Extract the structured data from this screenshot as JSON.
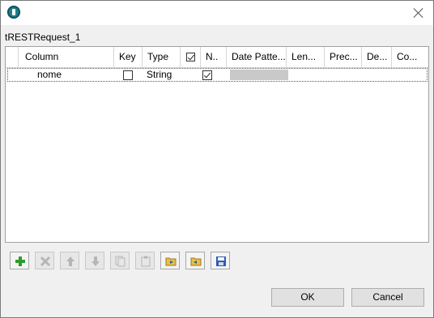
{
  "window": {
    "component_name": "tRESTRequest_1"
  },
  "table": {
    "columns": [
      "Column",
      "Key",
      "Type",
      "",
      "N..",
      "Date Patte...",
      "Len...",
      "Prec...",
      "De...",
      "Co..."
    ],
    "rows": [
      {
        "column": "nome",
        "key": false,
        "type": "String",
        "nullable": true,
        "date_pattern": "",
        "length": "",
        "precision": "",
        "default": "",
        "comment": ""
      }
    ]
  },
  "toolbar": {
    "buttons": [
      {
        "name": "add-button",
        "icon": "plus-icon",
        "enabled": true
      },
      {
        "name": "remove-button",
        "icon": "x-icon",
        "enabled": false
      },
      {
        "name": "move-up-button",
        "icon": "arrow-up-icon",
        "enabled": false
      },
      {
        "name": "move-down-button",
        "icon": "arrow-down-icon",
        "enabled": false
      },
      {
        "name": "copy-button",
        "icon": "copy-icon",
        "enabled": false
      },
      {
        "name": "paste-button",
        "icon": "paste-icon",
        "enabled": false
      },
      {
        "name": "import-button",
        "icon": "folder-import-icon",
        "enabled": true
      },
      {
        "name": "export-button",
        "icon": "folder-export-icon",
        "enabled": true
      },
      {
        "name": "save-button",
        "icon": "floppy-icon",
        "enabled": true
      }
    ]
  },
  "buttons": {
    "ok_label": "OK",
    "cancel_label": "Cancel"
  },
  "colors": {
    "accent": "#1e7f8a",
    "add_green": "#2e9b2e",
    "disabled_gray": "#b5b5b5",
    "save_blue": "#2d5bb5"
  }
}
